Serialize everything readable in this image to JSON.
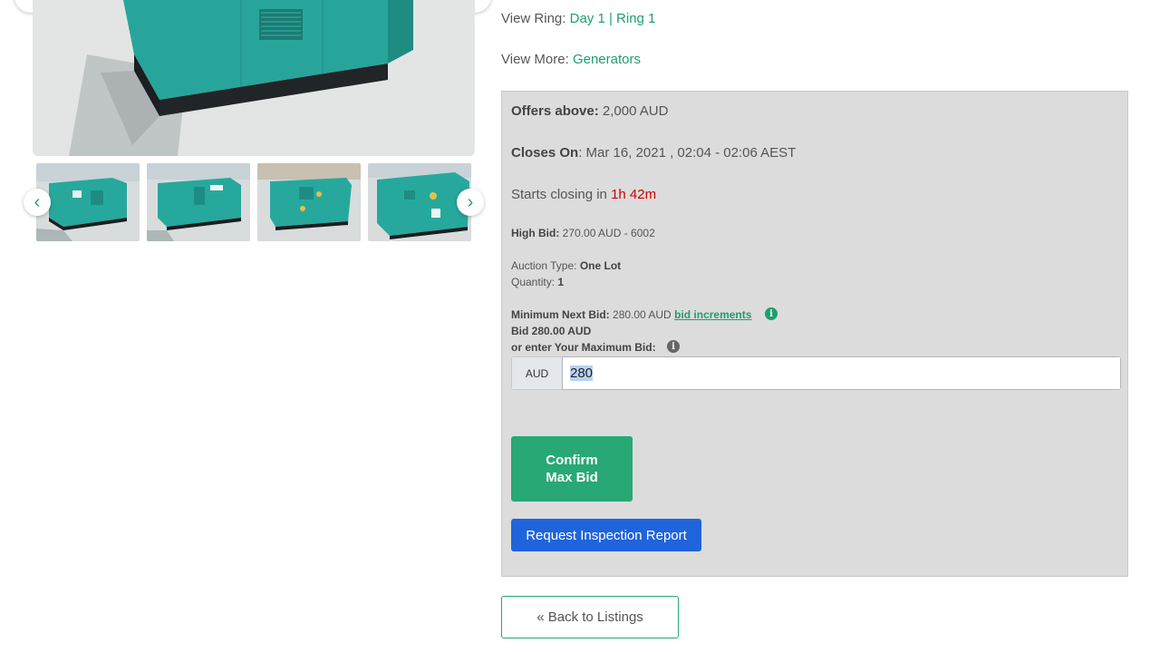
{
  "gallery": {
    "prev_icon": "chevron-left-icon",
    "next_icon": "chevron-right-icon",
    "prev_glyph": "‹",
    "next_glyph": "›",
    "thumbnail_count": 4
  },
  "view_ring": {
    "label": "View Ring:",
    "value": "Day 1 | Ring 1"
  },
  "view_more": {
    "label": "View More:",
    "value": "Generators"
  },
  "bid_panel": {
    "offers_above": {
      "label": "Offers above:",
      "value": "2,000 AUD"
    },
    "closes_on": {
      "label": "Closes On",
      "value": ": Mar 16, 2021 , 02:04 - 02:06 AEST"
    },
    "starts_closing": {
      "label": "Starts closing in",
      "value": "1h 42m"
    },
    "high_bid": {
      "label": "High Bid:",
      "value": "270.00 AUD - 6002"
    },
    "auction_type": {
      "label": "Auction Type:",
      "value": "One Lot"
    },
    "quantity": {
      "label": "Quantity:",
      "value": "1"
    },
    "min_next_bid": {
      "label": "Minimum Next Bid:",
      "value": "280.00 AUD",
      "link": "bid increments"
    },
    "bid_line": "Bid 280.00 AUD",
    "max_bid_label": "or enter Your Maximum Bid:",
    "currency": "AUD",
    "max_bid_value": "280",
    "confirm_line1": "Confirm",
    "confirm_line2": "Max Bid",
    "inspection_label": "Request Inspection Report"
  },
  "back_label": "« Back to Listings",
  "colors": {
    "accent": "#28a874",
    "link": "#1e9f6e",
    "countdown": "#d00000",
    "primary_button": "#1f64dc",
    "panel_bg": "#dcdcdc",
    "info_green": "#1e9f6e",
    "info_grey": "#666666"
  }
}
